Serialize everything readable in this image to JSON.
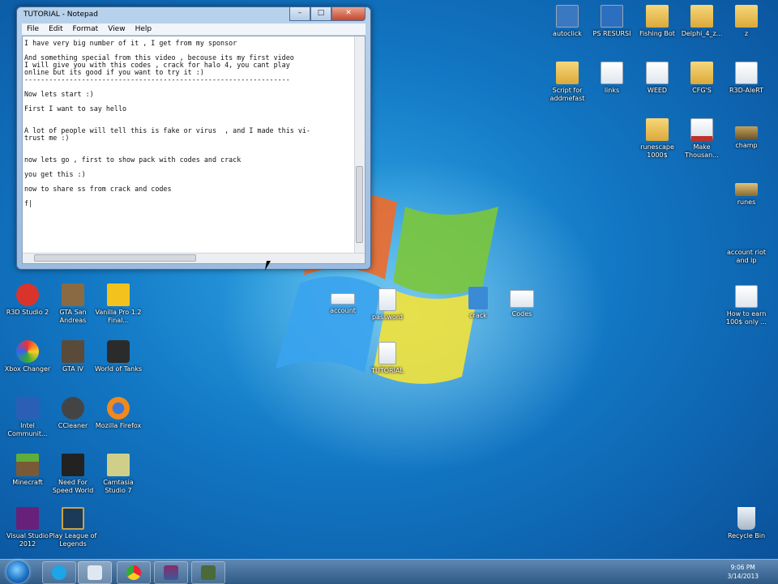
{
  "notepad": {
    "title": "TUTORIAL - Notepad",
    "menu": [
      "File",
      "Edit",
      "Format",
      "View",
      "Help"
    ],
    "controls": {
      "minimize": "–",
      "maximize": "□",
      "close": "✕"
    },
    "text": "I have very big number of it , I get from my sponsor\n\nAnd something special from this video , becouse its my first video\nI will give you with this codes , crack for halo 4, you cant play\nonline but its good if you want to try it :)\n-----------------------------------------------------------------\n\nNow lets start :)\n\nFirst I want to say hello\n\n\nA lot of people will tell this is fake or virus  , and I made this vi-\ntrust me :)\n\n\nnow lets go , first to show pack with codes and crack\n\nyou get this :)\n\nnow to share ss from crack and codes\n\nf|"
  },
  "desktop_icons_right": [
    {
      "label": "autoclick",
      "type": "file"
    },
    {
      "label": "PS RESURSI",
      "type": "file"
    },
    {
      "label": "Fishing Bot",
      "type": "folder"
    },
    {
      "label": "Delphi_4_z...",
      "type": "folder"
    },
    {
      "label": "z",
      "type": "folder"
    },
    {
      "label": "Script for addmefast",
      "type": "folder"
    },
    {
      "label": "links",
      "type": "file"
    },
    {
      "label": "WEED",
      "type": "file"
    },
    {
      "label": "CFG'S",
      "type": "folder"
    },
    {
      "label": "R3D-AleRT",
      "type": "file"
    },
    {
      "label": "runescape 1000$",
      "type": "folder"
    },
    {
      "label": "Make Thousan...",
      "type": "file"
    },
    {
      "label": "champ",
      "type": "file"
    },
    {
      "label": "runes",
      "type": "file"
    },
    {
      "label": "account riot and ip",
      "type": "file"
    },
    {
      "label": "How to earn 100$ only ...",
      "type": "file"
    },
    {
      "label": "Recycle Bin",
      "type": "file"
    }
  ],
  "desktop_icons_left": [
    {
      "label": "R3D Studio 2"
    },
    {
      "label": "GTA San Andreas"
    },
    {
      "label": "Vanilla Pro 1.2 Final..."
    },
    {
      "label": "Xbox Changer"
    },
    {
      "label": "GTA IV"
    },
    {
      "label": "World of Tanks"
    },
    {
      "label": "Intel Communit..."
    },
    {
      "label": "CCleaner"
    },
    {
      "label": "Mozilla Firefox"
    },
    {
      "label": "Minecraft"
    },
    {
      "label": "Need For Speed World"
    },
    {
      "label": "Camtasia Studio 7"
    },
    {
      "label": "Visual Studio 2012"
    },
    {
      "label": "Play League of Legends"
    }
  ],
  "desktop_icons_center": [
    {
      "label": "account"
    },
    {
      "label": "password"
    },
    {
      "label": "crack"
    },
    {
      "label": "Codes"
    },
    {
      "label": "TUTORIAL"
    }
  ],
  "taskbar": {
    "clock_time": "9:06 PM",
    "clock_date": "3/14/2013"
  },
  "colors": {
    "accent": "#1a6cc1",
    "taskbar": "#3b6590"
  }
}
